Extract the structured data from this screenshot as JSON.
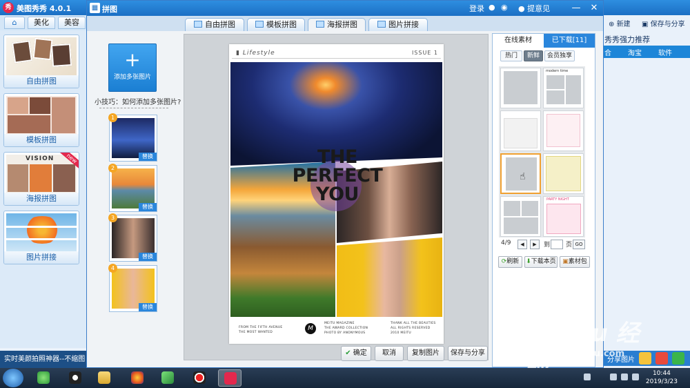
{
  "main_app": {
    "title": "美图秀秀 4.0.1",
    "logo": "秀",
    "tabs": [
      "美化",
      "美容"
    ],
    "home_icon": "home-icon",
    "features": [
      {
        "label": "自由拼图"
      },
      {
        "label": "模板拼图"
      },
      {
        "label": "海报拼图",
        "badge": "new",
        "thumb_text": "VISION"
      },
      {
        "label": "图片拼接"
      }
    ],
    "status_text": "实时美颜拍照神器--不缩图",
    "right_strip": {
      "new_label": "新建",
      "save_share_label": "保存与分享",
      "recommend_title": "秀秀强力推荐",
      "tabs": [
        "合",
        "淘宝",
        "软件"
      ],
      "share_label": "分享图片"
    }
  },
  "dialog": {
    "title": "拼图",
    "login": "登录",
    "feedback": "提意见",
    "minimize": "—",
    "close": "✕",
    "mode_tabs": [
      "自由拼图",
      "模板拼图",
      "海报拼图",
      "图片拼接"
    ],
    "active_mode": "海报拼图",
    "add_button": {
      "plus": "+",
      "label": "添加多张图片"
    },
    "tip": "小技巧：如何添加多张图片?",
    "slots": [
      {
        "num": "1",
        "replace": "替换"
      },
      {
        "num": "2",
        "replace": "替换"
      },
      {
        "num": "3",
        "replace": "替换"
      },
      {
        "num": "4",
        "replace": "替换"
      }
    ],
    "poster": {
      "section": "Lifestyle",
      "issue": "ISSUE 1",
      "headline": [
        "THE",
        "PERFECT",
        "YOU"
      ],
      "footer_left": [
        "FROM THE FIFTH AVENUE",
        "THE MOST WANTED"
      ],
      "logo_letter": "M",
      "footer_mid": [
        "MEITU MAGAZINE",
        "THE AWARD COLLECTION",
        "PHOTO BY ANONYMOUS"
      ],
      "footer_right": [
        "THANK ALL THE BEAUTIES",
        "ALL RIGHTS RESERVED",
        "2010 MEITU"
      ]
    },
    "buttons": {
      "confirm": "确定",
      "cancel": "取消",
      "copy": "复制图片",
      "save_share": "保存与分享"
    },
    "material_panel": {
      "tabs": [
        "在线素材",
        "已下载[11]"
      ],
      "subtabs": [
        "热门",
        "新鲜",
        "会员独享"
      ],
      "active_subtab": "新鲜",
      "template_texts": [
        "modern time",
        "PARTY NIGHT"
      ],
      "page": "4/9",
      "goto_label": "到",
      "page_unit": "页",
      "go": "GO",
      "actions": [
        "刷新",
        "下载本页",
        "素材包"
      ]
    }
  },
  "taskbar": {
    "time": "10:44",
    "date": "2019/3/23"
  },
  "watermark": {
    "brand": "Bai du 经验",
    "url": "jingyan.baidu.com"
  }
}
